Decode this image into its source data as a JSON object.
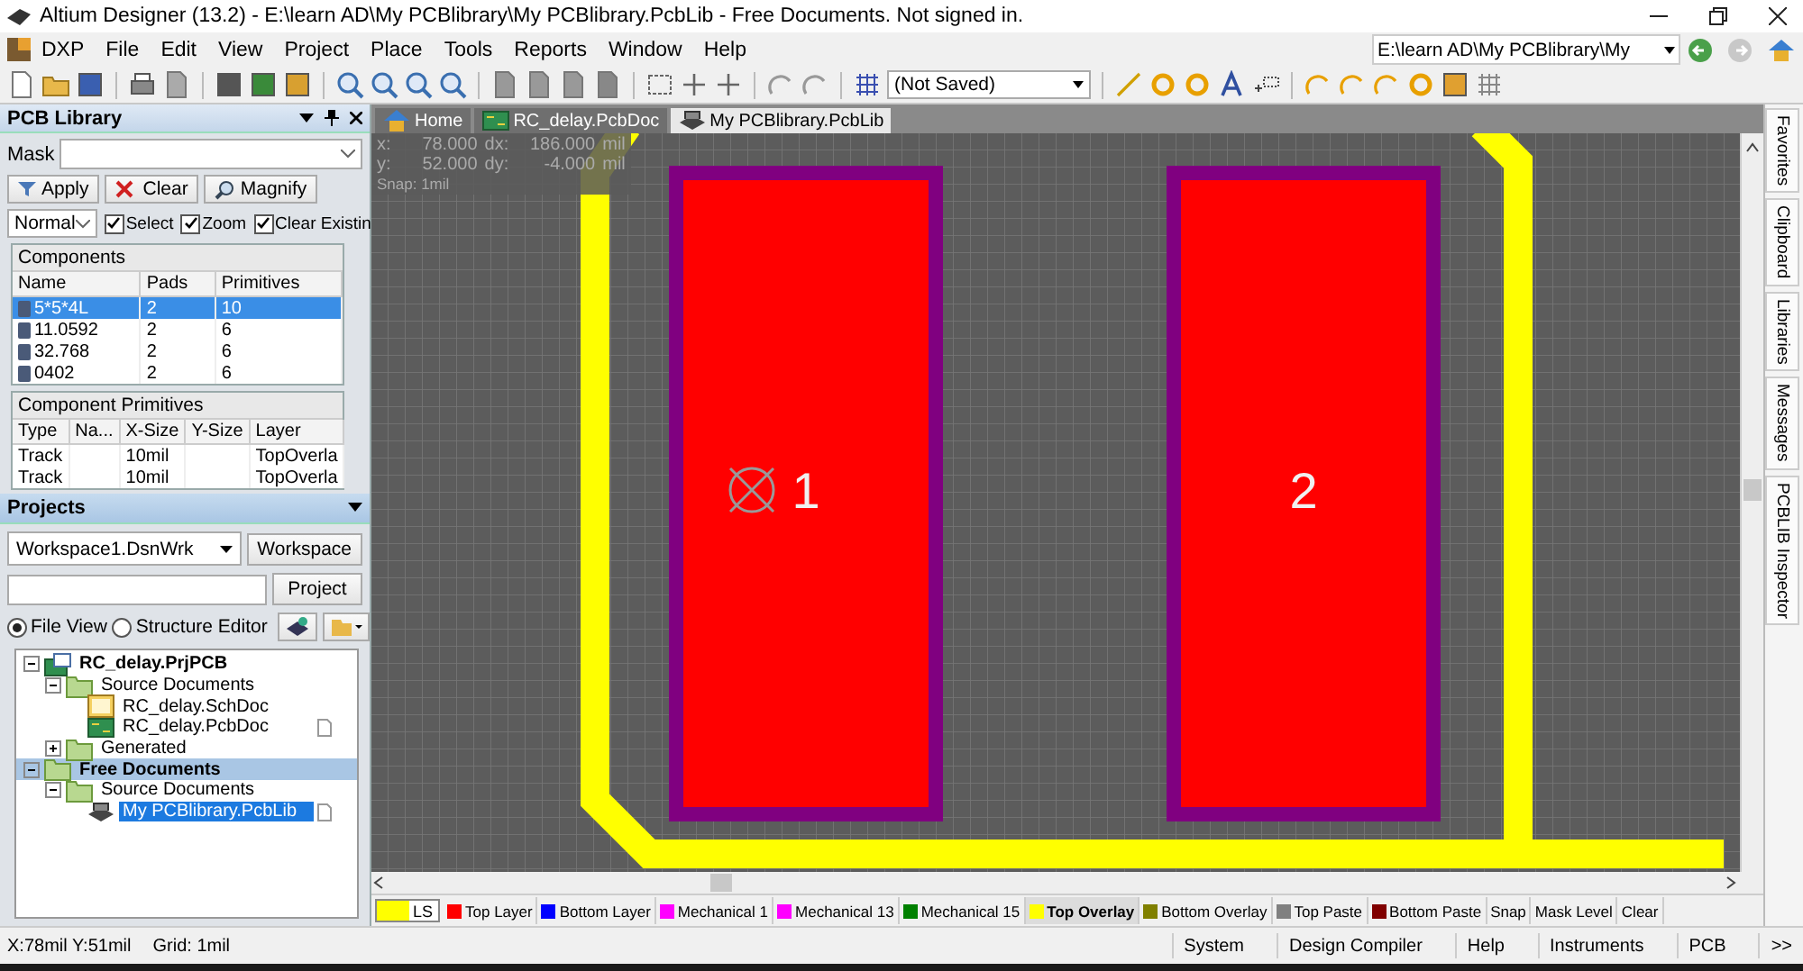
{
  "window": {
    "title": "Altium Designer (13.2) - E:\\learn AD\\My PCBlibrary\\My PCBlibrary.PcbLib - Free Documents. Not signed in."
  },
  "menu": [
    "DXP",
    "File",
    "Edit",
    "View",
    "Project",
    "Place",
    "Tools",
    "Reports",
    "Window",
    "Help"
  ],
  "nav": {
    "path": "E:\\learn AD\\My PCBlibrary\\My"
  },
  "toolbar": {
    "document_status": "(Not Saved)"
  },
  "pcb_library": {
    "title": "PCB Library",
    "mask_label": "Mask",
    "buttons": [
      "Apply",
      "Clear",
      "Magnify"
    ],
    "mode": "Normal",
    "checkboxes": [
      {
        "label": "Select",
        "checked": true
      },
      {
        "label": "Zoom",
        "checked": true
      },
      {
        "label": "Clear Existin",
        "checked": true
      }
    ],
    "components": {
      "title": "Components",
      "columns": [
        "Name",
        "Pads",
        "Primitives"
      ],
      "rows": [
        {
          "name": "5*5*4L",
          "pads": "2",
          "primitives": "10",
          "selected": true
        },
        {
          "name": "11.0592",
          "pads": "2",
          "primitives": "6",
          "selected": false
        },
        {
          "name": "32.768",
          "pads": "2",
          "primitives": "6",
          "selected": false
        },
        {
          "name": "0402",
          "pads": "2",
          "primitives": "6",
          "selected": false
        }
      ]
    },
    "primitives": {
      "title": "Component Primitives",
      "columns": [
        "Type",
        "Na...",
        "X-Size",
        "Y-Size",
        "Layer"
      ],
      "rows": [
        {
          "type": "Track",
          "x_size": "10mil",
          "layer": "TopOverla"
        },
        {
          "type": "Track",
          "x_size": "10mil",
          "layer": "TopOverla"
        }
      ]
    }
  },
  "projects": {
    "title": "Projects",
    "workspace": "Workspace1.DsnWrk",
    "buttons": [
      "Workspace",
      "Project"
    ],
    "views": [
      {
        "label": "File View",
        "selected": true
      },
      {
        "label": "Structure Editor",
        "selected": false
      }
    ],
    "tree": [
      {
        "label": "RC_delay.PrjPCB",
        "kind": "project",
        "expanded": true,
        "selected": false,
        "children": [
          {
            "label": "Source Documents",
            "kind": "folder",
            "expanded": true,
            "selected": false,
            "children": [
              {
                "label": "RC_delay.SchDoc",
                "kind": "schdoc",
                "selected": false,
                "open": false
              },
              {
                "label": "RC_delay.PcbDoc",
                "kind": "pcbdoc",
                "selected": false,
                "open": true
              }
            ]
          },
          {
            "label": "Generated",
            "kind": "folder",
            "expanded": false,
            "selected": false
          }
        ]
      },
      {
        "label": "Free Documents",
        "kind": "group",
        "expanded": true,
        "selected": false,
        "children": [
          {
            "label": "Source Documents",
            "kind": "folder",
            "expanded": true,
            "selected": false,
            "children": [
              {
                "label": "My PCBlibrary.PcbLib",
                "kind": "pcblib",
                "selected": true,
                "open": true
              }
            ]
          }
        ]
      }
    ]
  },
  "document_tabs": [
    {
      "label": "Home",
      "kind": "home",
      "selected": false
    },
    {
      "label": "RC_delay.PcbDoc",
      "kind": "pcbdoc",
      "selected": false
    },
    {
      "label": "My PCBlibrary.PcbLib",
      "kind": "pcblib",
      "selected": true
    }
  ],
  "readout": {
    "rows": [
      {
        "label": "x:",
        "value": "78.000",
        "delta_label": "dx:",
        "delta": "186.000",
        "unit": "mil"
      },
      {
        "label": "y:",
        "value": "52.000",
        "delta_label": "dy:",
        "delta": "-4.000",
        "unit": "mil"
      }
    ],
    "snap": "Snap: 1mil"
  },
  "pads": [
    {
      "label": "1",
      "origin_marker": true
    },
    {
      "label": "2",
      "origin_marker": false
    }
  ],
  "current_layer": {
    "label": "LS",
    "color": "#ffff00"
  },
  "layer_tabs": [
    {
      "label": "Top Layer",
      "color": "#ff0000",
      "selected": false
    },
    {
      "label": "Bottom Layer",
      "color": "#0000ff",
      "selected": false
    },
    {
      "label": "Mechanical 1",
      "color": "#ff00ff",
      "selected": false
    },
    {
      "label": "Mechanical 13",
      "color": "#ff00ff",
      "selected": false
    },
    {
      "label": "Mechanical 15",
      "color": "#008000",
      "selected": false
    },
    {
      "label": "Top Overlay",
      "color": "#ffff00",
      "selected": true
    },
    {
      "label": "Bottom Overlay",
      "color": "#808000",
      "selected": false
    },
    {
      "label": "Top Paste",
      "color": "#808080",
      "selected": false
    },
    {
      "label": "Bottom Paste",
      "color": "#800000",
      "selected": false
    }
  ],
  "layer_buttons": [
    "Snap",
    "Mask Level",
    "Clear"
  ],
  "side_panels": [
    "Favorites",
    "Clipboard",
    "Libraries",
    "Messages",
    "PCBLIB Inspector"
  ],
  "status_bar": {
    "position": "X:78mil Y:51mil",
    "grid": "Grid: 1mil",
    "buttons": [
      "System",
      "Design Compiler",
      "Help",
      "Instruments",
      "PCB",
      ">>"
    ]
  }
}
